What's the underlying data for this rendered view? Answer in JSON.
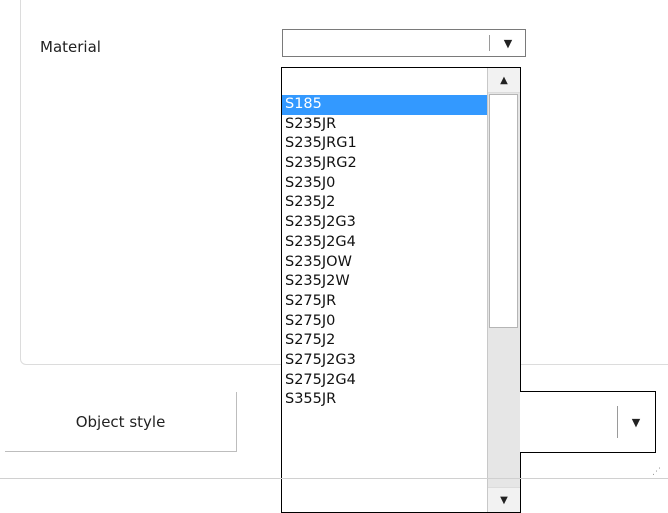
{
  "material": {
    "label": "Material",
    "value": "",
    "dropdown_icon": "chevron-down-icon"
  },
  "dropdown_list": {
    "items": [
      "",
      "S185",
      "S235JR",
      "S235JRG1",
      "S235JRG2",
      "S235J0",
      "S235J2",
      "S235J2G3",
      "S235J2G4",
      "S235JOW",
      "S235J2W",
      "S275JR",
      "S275J0",
      "S275J2",
      "S275J2G3",
      "S275J2G4",
      "S355JR"
    ],
    "selected": "S185",
    "selection_color": "#3399ff"
  },
  "object_style": {
    "button_label": "Object style",
    "value": "",
    "dropdown_icon": "chevron-down-icon"
  }
}
